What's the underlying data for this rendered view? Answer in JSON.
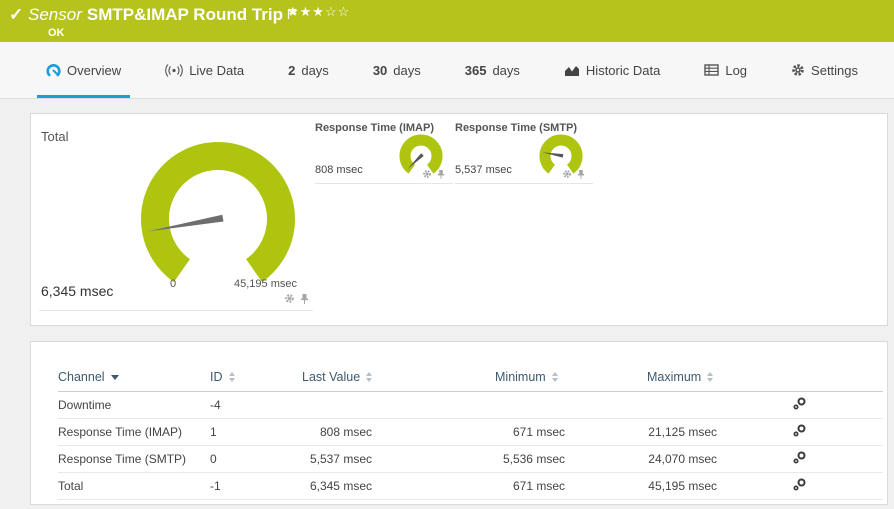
{
  "header": {
    "kind_label": "Sensor",
    "title": "SMTP&IMAP Round Trip",
    "status": "OK",
    "rating_stars": "★★★☆☆",
    "background_color": "#b5c31c"
  },
  "tabs": {
    "active_color": "#1b9dd9",
    "items": [
      {
        "label": "Overview",
        "icon": "gauge-icon",
        "active": true
      },
      {
        "label": "Live Data",
        "icon": "broadcast-icon",
        "active": false
      },
      {
        "prefix": "2",
        "label": "days",
        "active": false
      },
      {
        "prefix": "30",
        "label": "days",
        "active": false
      },
      {
        "prefix": "365",
        "label": "days",
        "active": false
      },
      {
        "label": "Historic Data",
        "icon": "chart-icon",
        "active": false
      },
      {
        "label": "Log",
        "icon": "log-icon",
        "active": false
      },
      {
        "label": "Settings",
        "icon": "gear-icon",
        "active": false
      }
    ]
  },
  "gauges": {
    "accent_color": "#afc40f",
    "needle_color": "#6e6e6e",
    "total": {
      "label": "Total",
      "value": "6,345 msec",
      "min": "0",
      "max": "45,195 msec"
    },
    "imap": {
      "label": "Response Time (IMAP)",
      "value": "808 msec"
    },
    "smtp": {
      "label": "Response Time (SMTP)",
      "value": "5,537 msec"
    }
  },
  "table": {
    "columns": [
      "Channel",
      "ID",
      "Last Value",
      "Minimum",
      "Maximum"
    ],
    "rows": [
      {
        "channel": "Downtime",
        "id": "-4",
        "last": "",
        "min": "",
        "max": ""
      },
      {
        "channel": "Response Time (IMAP)",
        "id": "1",
        "last": "808 msec",
        "min": "671 msec",
        "max": "21,125 msec"
      },
      {
        "channel": "Response Time (SMTP)",
        "id": "0",
        "last": "5,537 msec",
        "min": "5,536 msec",
        "max": "24,070 msec"
      },
      {
        "channel": "Total",
        "id": "-1",
        "last": "6,345 msec",
        "min": "671 msec",
        "max": "45,195 msec"
      }
    ]
  }
}
